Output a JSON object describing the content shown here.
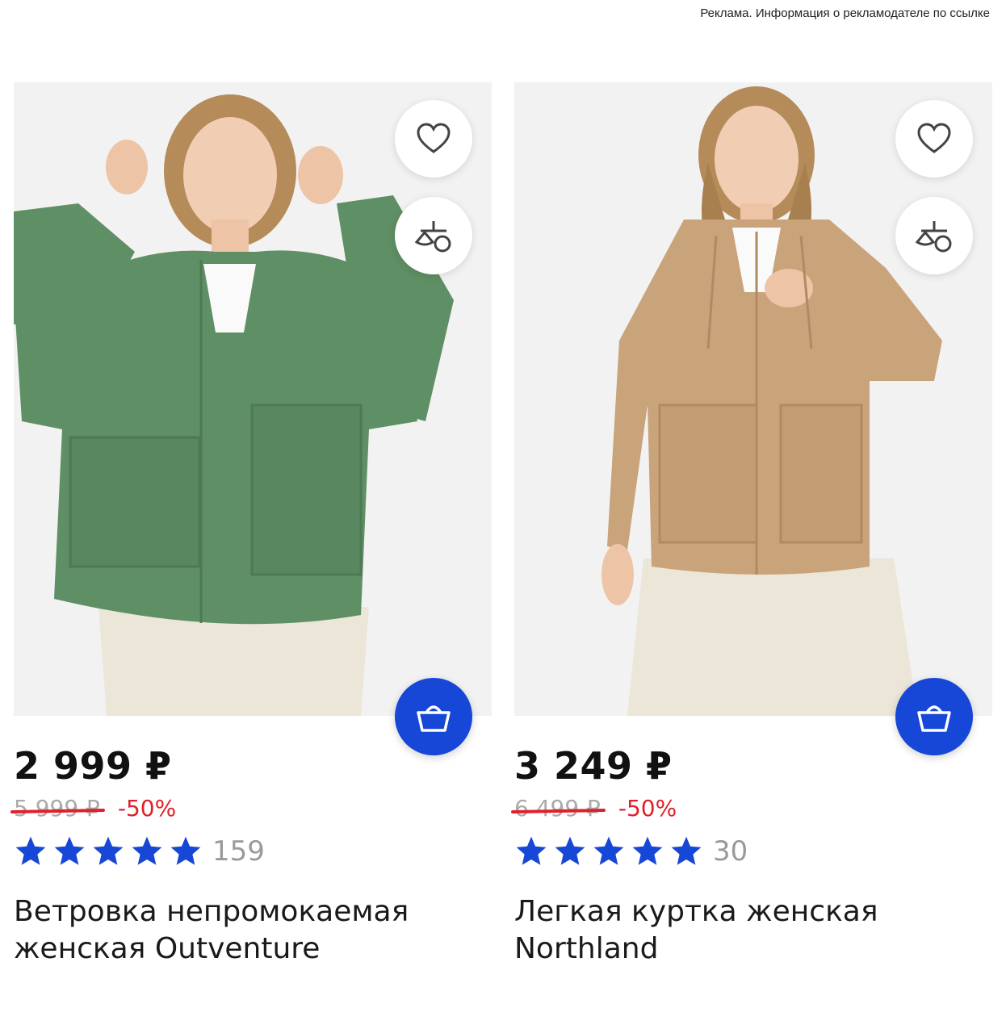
{
  "ad_notice": "Реклама. Информация о рекламодателе по ссылке",
  "colors": {
    "accent": "#1747d6",
    "discount": "#e0202a",
    "star": "#1747d6"
  },
  "products": [
    {
      "price": "2 999 ₽",
      "old_price": "5 999 ₽",
      "discount": "-50%",
      "rating": 5,
      "reviews": "159",
      "title": "Ветровка непромокаемая женская Outventure",
      "jacket_color": "#5f8f64"
    },
    {
      "price": "3 249 ₽",
      "old_price": "6 499 ₽",
      "discount": "-50%",
      "rating": 5,
      "reviews": "30",
      "title": "Легкая куртка женская Northland",
      "jacket_color": "#c9a37a"
    }
  ],
  "icons": {
    "favorite": "heart-icon",
    "compare": "scales-icon",
    "cart": "basket-icon",
    "rating": "star-icon"
  }
}
